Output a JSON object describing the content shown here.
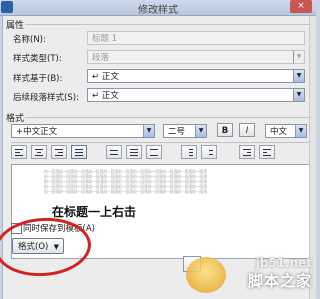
{
  "window": {
    "title": "修改样式",
    "close_label": "×"
  },
  "properties": {
    "section_label": "属性",
    "name_label": "名称(N):",
    "name_value": "标题 1",
    "type_label": "样式类型(T):",
    "type_value": "段落",
    "based_on_label": "样式基于(B):",
    "based_on_value": "↵ 正文",
    "next_label": "后续段落样式(S):",
    "next_value": "↵ 正文"
  },
  "format": {
    "section_label": "格式",
    "font_value": "+中文正文",
    "size_value": "二号",
    "bold_label": "B",
    "italic_label": "I",
    "lang_value": "中文"
  },
  "preview": {
    "sample_line": "前一段落前一段落前一段落前一段落前一段落前一段落前一段落前一段落前一段落前一段落前一段落",
    "main_text": "在标题一上右击"
  },
  "bottom": {
    "add_to_template_label": "同时保存到模板(A)",
    "format_button_label": "格式(O)",
    "format_button_arrow": "▼"
  },
  "watermark": {
    "site": "jb51.net",
    "name": "脚本之家"
  },
  "colors": {
    "accent": "#2e5fa8",
    "annotation": "#d42222"
  }
}
